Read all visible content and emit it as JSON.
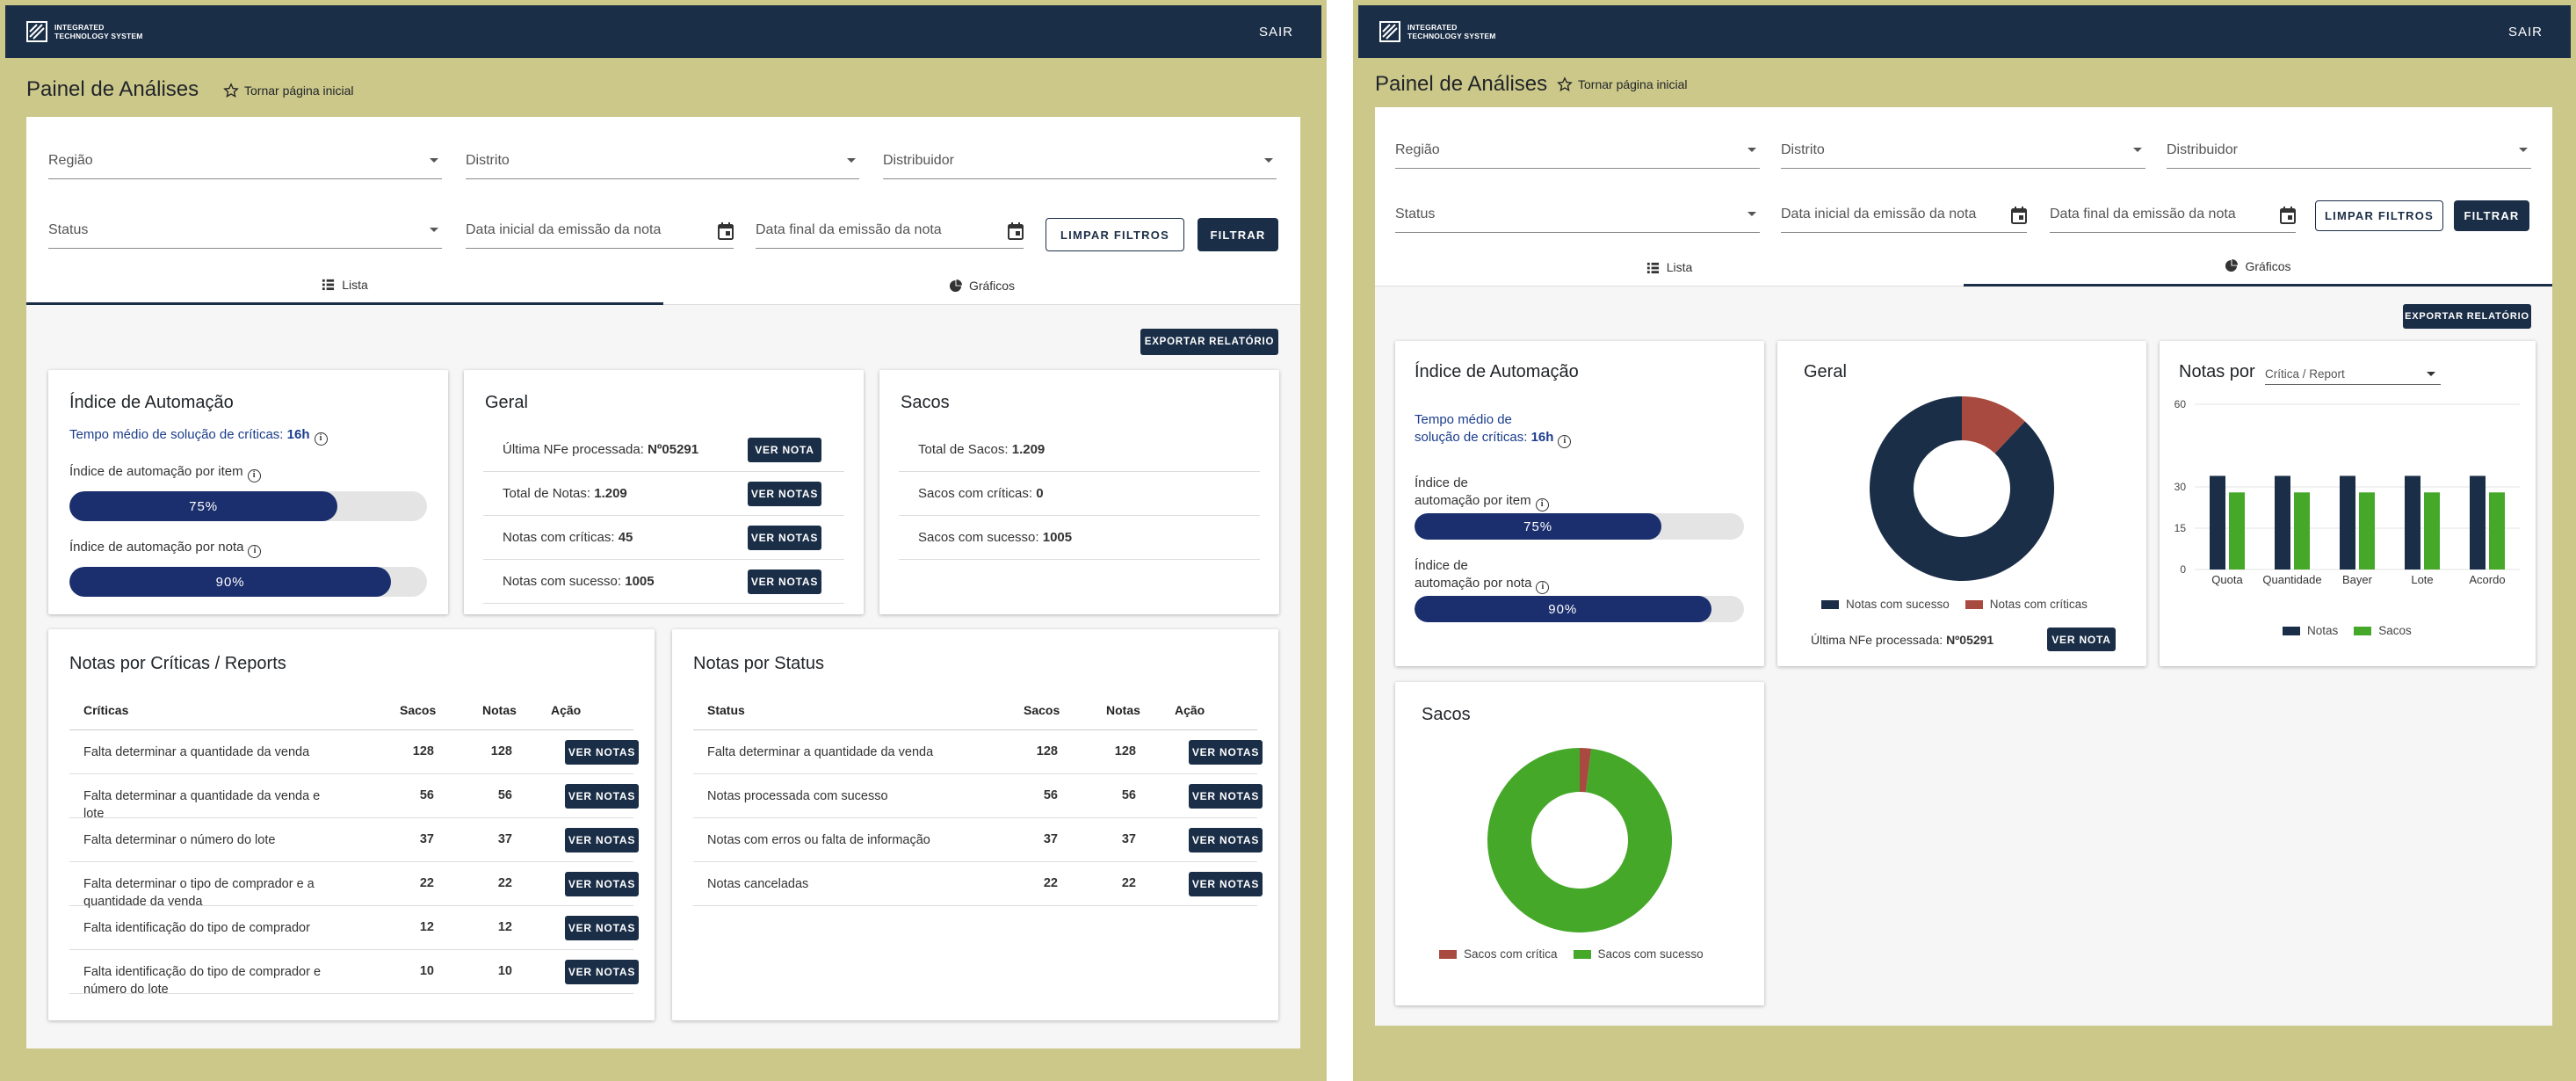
{
  "app": {
    "logo_line1": "INTEGRATED",
    "logo_line2": "TECHNOLOGY SYSTEM",
    "logout": "SAIR"
  },
  "page": {
    "title": "Painel de Análises",
    "home_link": "Tornar página inicial"
  },
  "filters": {
    "region": "Região",
    "district": "Distrito",
    "distributor": "Distribuidor",
    "status": "Status",
    "date_start": "Data inicial da emissão da nota",
    "date_end": "Data final da emissão da nota",
    "clear": "LIMPAR FILTROS",
    "filter": "FILTRAR"
  },
  "tabs": {
    "list": "Lista",
    "charts": "Gráficos"
  },
  "export": "EXPORTAR RELATÓRIO",
  "automation": {
    "title": "Índice de Automação",
    "avg_label": "Tempo médio de solução de críticas:",
    "avg_value": "16h",
    "avg_label_line1": "Tempo médio de",
    "avg_label_line2": "solução de críticas:",
    "item_label": "Índice de automação por item",
    "item_label_line1": "Índice de",
    "item_label_line2": "automação por item",
    "item_value": "75%",
    "item_pct": 75,
    "note_label": "Índice de automação por nota",
    "note_label_line1": "Índice de",
    "note_label_line2": "automação por nota",
    "note_value": "90%",
    "note_pct": 90
  },
  "geral": {
    "title": "Geral",
    "rows": [
      {
        "label": "Última NFe processada:",
        "value": "Nº05291",
        "btn": "VER NOTA"
      },
      {
        "label": "Total de Notas:",
        "value": "1.209",
        "btn": "VER NOTAS"
      },
      {
        "label": "Notas com críticas:",
        "value": "45",
        "btn": "VER NOTAS"
      },
      {
        "label": "Notas com sucesso:",
        "value": "1005",
        "btn": "VER NOTAS"
      }
    ],
    "legend_success": "Notas com sucesso",
    "legend_critical": "Notas com críticas",
    "last_label": "Última NFe processada:",
    "last_value": "Nº05291",
    "last_btn": "VER NOTA",
    "donut": {
      "success_pct": 0.88,
      "critical_pct": 0.12
    }
  },
  "sacos": {
    "title": "Sacos",
    "rows": [
      {
        "label": "Total de Sacos:",
        "value": "1.209"
      },
      {
        "label": "Sacos com críticas:",
        "value": "0"
      },
      {
        "label": "Sacos com sucesso:",
        "value": "1005"
      }
    ],
    "legend_critical": "Sacos com crítica",
    "legend_success": "Sacos com sucesso",
    "donut": {
      "critical_pct": 0.02,
      "success_pct": 0.98
    }
  },
  "criticas": {
    "title": "Notas por Críticas / Reports",
    "headers": [
      "Críticas",
      "Sacos",
      "Notas",
      "Ação"
    ],
    "rows": [
      {
        "label": "Falta determinar a quantidade da venda",
        "sacos": "128",
        "notas": "128",
        "btn": "VER NOTAS"
      },
      {
        "label": "Falta determinar a quantidade da venda e lote",
        "sacos": "56",
        "notas": "56",
        "btn": "VER NOTAS"
      },
      {
        "label": "Falta determinar o número do lote",
        "sacos": "37",
        "notas": "37",
        "btn": "VER NOTAS"
      },
      {
        "label": "Falta determinar o tipo de comprador e a quantidade da venda",
        "sacos": "22",
        "notas": "22",
        "btn": "VER NOTAS"
      },
      {
        "label": "Falta identificação do tipo de comprador",
        "sacos": "12",
        "notas": "12",
        "btn": "VER NOTAS"
      },
      {
        "label": "Falta identificação do tipo de comprador e número do lote",
        "sacos": "10",
        "notas": "10",
        "btn": "VER NOTAS"
      }
    ]
  },
  "status_table": {
    "title": "Notas por Status",
    "headers": [
      "Status",
      "Sacos",
      "Notas",
      "Ação"
    ],
    "rows": [
      {
        "label": "Falta determinar a quantidade da venda",
        "sacos": "128",
        "notas": "128",
        "btn": "VER NOTAS"
      },
      {
        "label": "Notas processada com sucesso",
        "sacos": "56",
        "notas": "56",
        "btn": "VER NOTAS"
      },
      {
        "label": "Notas com erros ou falta de informação",
        "sacos": "37",
        "notas": "37",
        "btn": "VER NOTAS"
      },
      {
        "label": "Notas canceladas",
        "sacos": "22",
        "notas": "22",
        "btn": "VER NOTAS"
      }
    ]
  },
  "notas_por": {
    "title": "Notas por",
    "select_value": "Crítica / Report"
  },
  "colors": {
    "navy": "#1b2e47",
    "accent_red": "#a84a3f",
    "green": "#45a829",
    "olive": "#ccc88a"
  },
  "chart_data": {
    "type": "bar",
    "categories": [
      "Quota",
      "Quantidade",
      "Bayer",
      "Lote",
      "Acordo"
    ],
    "series": [
      {
        "name": "Notas",
        "values": [
          34,
          34,
          34,
          34,
          34
        ]
      },
      {
        "name": "Sacos",
        "values": [
          28,
          28,
          28,
          28,
          28
        ]
      }
    ],
    "ylim": [
      0,
      60
    ],
    "yticks": [
      "0",
      "15",
      "30",
      "60"
    ],
    "legend": "bottom"
  }
}
